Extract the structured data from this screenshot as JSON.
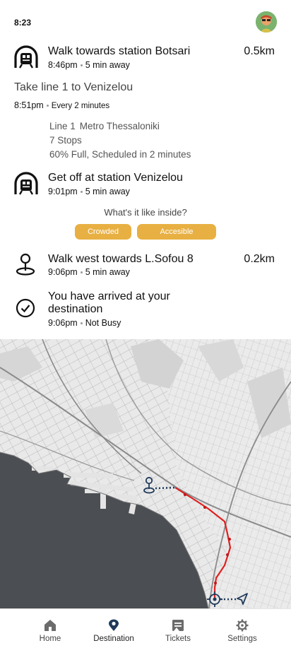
{
  "status_bar": {
    "time": "8:23"
  },
  "colors": {
    "accent": "#e8b042",
    "primary": "#1f3a5a",
    "route": "#e02020"
  },
  "steps": {
    "walk_to_station": {
      "icon": "metro-station-icon",
      "title": "Walk towards station Botsari",
      "time": "8:46pm",
      "eta": "5 min away",
      "distance": "0.5km"
    },
    "take_line": {
      "title": "Take line 1 to Venizelou",
      "time": "8:51pm",
      "frequency": "Every 2 minutes"
    },
    "line_details": {
      "line": "Line 1",
      "operator": "Metro Thessaloniki",
      "stops": "7 Stops",
      "occupancy": "60% Full, Scheduled in 2 minutes"
    },
    "get_off": {
      "icon": "metro-station-icon",
      "title": "Get off at station Venizelou",
      "time": "9:01pm",
      "eta": "5 min away"
    },
    "walk_west": {
      "icon": "location-pin-icon",
      "title": "Walk west towards L.Sofou 8",
      "time": "9:06pm",
      "eta": "5 min away",
      "distance": "0.2km"
    },
    "arrived": {
      "icon": "check-circle-icon",
      "title_line1": "You have arrived at your",
      "title_line2": "destination",
      "time": "9:06pm",
      "status": "Not Busy"
    }
  },
  "feedback": {
    "question": "What's it like inside?",
    "options": [
      "Crowded",
      "Accesible"
    ]
  },
  "tabbar": {
    "tabs": [
      {
        "label": "Home",
        "icon": "home-icon",
        "active": false
      },
      {
        "label": "Destination",
        "icon": "map-pin-icon",
        "active": true
      },
      {
        "label": "Tickets",
        "icon": "ticket-icon",
        "active": false
      },
      {
        "label": "Settings",
        "icon": "gear-icon",
        "active": false
      }
    ]
  }
}
